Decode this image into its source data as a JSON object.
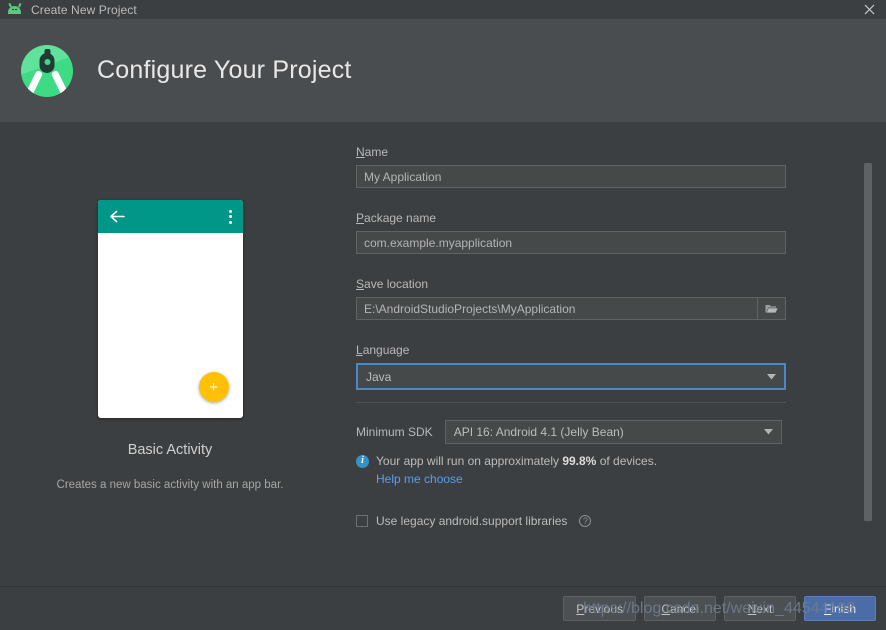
{
  "window": {
    "title": "Create New Project",
    "app_icon": "android-bugdroid-icon",
    "close_icon": "close-icon"
  },
  "header": {
    "title": "Configure Your Project",
    "logo_icon": "android-studio-logo-icon"
  },
  "preview": {
    "template_name": "Basic Activity",
    "template_description": "Creates a new basic activity with an app bar.",
    "appbar_color": "#009688",
    "fab_color": "#ffc107",
    "back_icon": "back-arrow-icon",
    "overflow_icon": "overflow-menu-icon",
    "fab_label": "+"
  },
  "form": {
    "name": {
      "label": "Name",
      "mnemonic": "N",
      "rest": "ame",
      "value": "My Application"
    },
    "package_name": {
      "label": "Package name",
      "mnemonic": "P",
      "rest": "ackage name",
      "value": "com.example.myapplication"
    },
    "save_location": {
      "label": "Save location",
      "mnemonic": "S",
      "rest": "ave location",
      "value": "E:\\AndroidStudioProjects\\MyApplication",
      "browse_icon": "folder-icon"
    },
    "language": {
      "label": "Language",
      "mnemonic": "L",
      "rest": "anguage",
      "value": "Java",
      "focused": true,
      "focus_color": "#4a88c7",
      "caret_icon": "chevron-down-icon"
    },
    "minimum_sdk": {
      "label": "Minimum SDK",
      "value": "API 16: Android 4.1 (Jelly Bean)",
      "caret_icon": "chevron-down-icon"
    },
    "device_info": {
      "icon": "info-icon",
      "icon_color": "#3592c4",
      "text_before": "Your app will run on approximately ",
      "percent": "99.8%",
      "text_after": " of devices."
    },
    "help_link": {
      "label": "Help me choose",
      "color": "#589df6"
    },
    "legacy_checkbox": {
      "label": "Use legacy android.support libraries",
      "checked": false,
      "help_icon": "question-mark-icon"
    }
  },
  "footer": {
    "previous": {
      "label": "Previous",
      "mnemonic": "P",
      "rest": "revious"
    },
    "cancel": {
      "label": "Cancel",
      "mnemonic": "C",
      "rest": "ancel"
    },
    "next": {
      "label": "Next",
      "mnemonic": "N",
      "rest": "ext"
    },
    "finish": {
      "label": "Finish",
      "mnemonic": "F",
      "rest": "inish",
      "primary": true,
      "color": "#4a6da7"
    }
  },
  "overlay": {
    "watermark": "https://blog.csdn.net/weixin_44544198"
  }
}
